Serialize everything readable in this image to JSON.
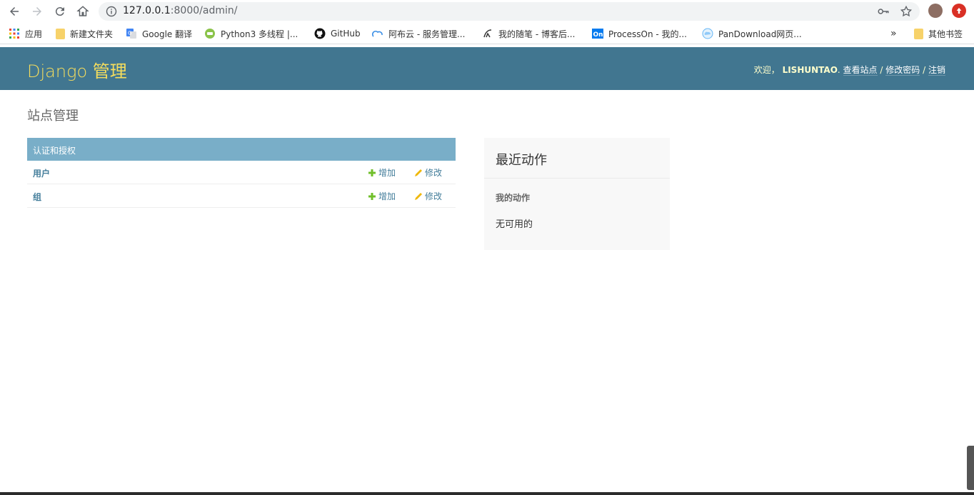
{
  "browser": {
    "url_host": "127.0.0.1",
    "url_path": ":8000/admin/",
    "bookmarks": [
      {
        "label": "应用",
        "icon": "apps-grid-icon"
      },
      {
        "label": "新建文件夹",
        "icon": "folder-icon"
      },
      {
        "label": "Google 翻译",
        "icon": "google-translate-icon"
      },
      {
        "label": "Python3 多线程 |...",
        "icon": "runoob-icon"
      },
      {
        "label": "GitHub",
        "icon": "github-icon"
      },
      {
        "label": "阿布云 - 服务管理...",
        "icon": "cloud-icon"
      },
      {
        "label": "我的随笔 - 博客后...",
        "icon": "cnblogs-icon"
      },
      {
        "label": "ProcessOn - 我的...",
        "icon": "processon-icon"
      },
      {
        "label": "PanDownload网页...",
        "icon": "pandownload-icon"
      }
    ],
    "more_label": "»",
    "other_bookmarks": "其他书签"
  },
  "header": {
    "branding": "Django 管理",
    "welcome": "欢迎，",
    "username": "LISHUNTAO",
    "dot": ".",
    "view_site": "查看站点",
    "sep1": "/",
    "change_password": "修改密码",
    "sep2": "/",
    "logout": "注销"
  },
  "page_title": "站点管理",
  "app_module": {
    "caption": "认证和授权",
    "rows": [
      {
        "name": "用户",
        "add": "增加",
        "change": "修改"
      },
      {
        "name": "组",
        "add": "增加",
        "change": "修改"
      }
    ]
  },
  "recent_actions": {
    "title": "最近动作",
    "subtitle": "我的动作",
    "empty": "无可用的"
  },
  "colors": {
    "header_bg": "#417690",
    "branding": "#f5dd5d",
    "module_caption_bg": "#79aec8",
    "link": "#447e9b",
    "add_icon": "#70bf2b",
    "change_icon": "#efb80b"
  }
}
